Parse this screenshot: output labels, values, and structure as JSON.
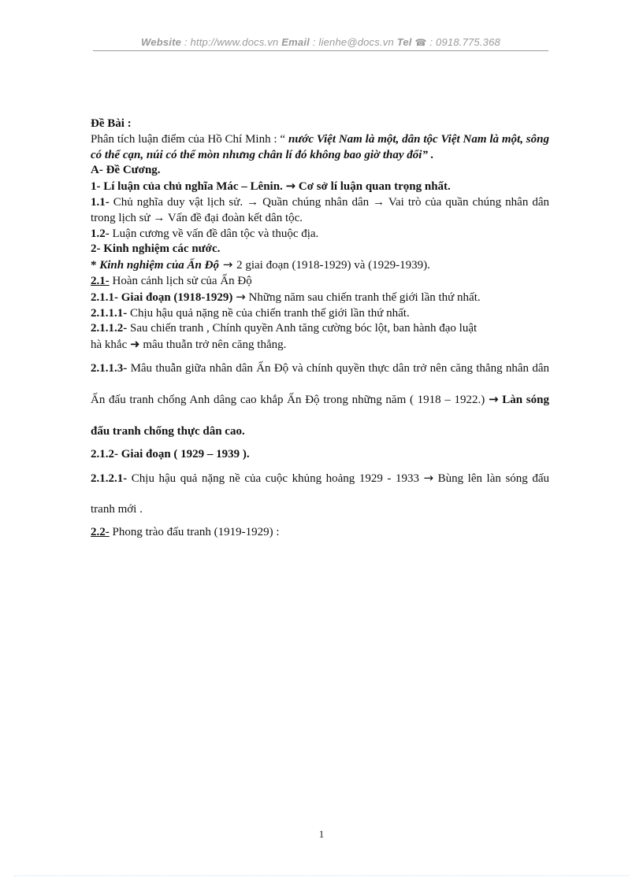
{
  "header": {
    "website_label": "Website",
    "website_sep": " : ",
    "website_url": "http://www.docs.vn",
    "email_label": "Email",
    "email_sep": "  : ",
    "email_value": "lienhe@docs.vn",
    "tel_label": "Tel",
    "phone_icon": "telephone-icon",
    "phone_glyph": "☎",
    "tel_sep": " : ",
    "tel_value": "0918.775.368"
  },
  "document": {
    "title": "Đề Bài :",
    "prompt_lead": "Phân tích luận  điểm  của Hồ Chí Minh  : “ ",
    "prompt_quote": "nước Việt Nam là một, dân tộc Việt Nam là một, sông có thể cạn, núi có thể mòn nhưng chân lí đó không bao giờ thay đổi",
    "prompt_tail": "” .",
    "section_a": "A- Đề Cương.",
    "outline": [
      {
        "id": "1",
        "num": "1- Lí luận  của chủ nghĩa Mác – Lênin. ",
        "arrow": "→",
        "rest": " Cơ sở lí luận  quan trọng nhất."
      },
      {
        "id": "1.1",
        "num": "1.1- ",
        "text": "Chủ nghĩa  duy vật lịch  sử. → Quần chúng nhân  dân → Vai trò của quần chúng nhân dân trong  lịch  sử → Vấn đề đại đoàn kết dân tộc."
      },
      {
        "id": "1.2",
        "num": "1.2- ",
        "text": "Luận  cương về vấn  đề dân tộc và thuộc  địa."
      },
      {
        "id": "2",
        "num": "2- Kinh  nghiệm  các nước."
      },
      {
        "id": "2-star",
        "star": "* ",
        "bolditalic": "Kinh nghiệm của Ấn Độ",
        "arrow": " → ",
        "rest": "2 giai  đoạn (1918-1929) và (1929-1939)."
      },
      {
        "id": "2.1",
        "num": "2.1-",
        "text": " Hoàn cảnh lịch  sử của Ấn Độ"
      },
      {
        "id": "2.1.1",
        "num": "2.1.1- Giai đoạn (1918-1929) ",
        "arrow": "→",
        "rest": " Những năm sau chiến  tranh thế giới  lần thứ nhất."
      },
      {
        "id": "2.1.1.1",
        "num": "2.1.1.1- ",
        "text": "Chịu hậu  quả nặng  nề của chiến  tranh thế giới  lần thứ nhất."
      },
      {
        "id": "2.1.1.2",
        "num": "2.1.1.2- ",
        "text": "Sau chiến  tranh , Chính  quyền Anh tăng cường bóc lột, ban hành  đạo luật",
        "line2_pre": "hà khắc ",
        "line2_arrow": "➜",
        "line2_post": " mâu  thuẫn trở nên  căng  thẳng."
      },
      {
        "id": "2.1.1.3",
        "num": "2.1.1.3- ",
        "text": "Mâu thuẫn  giữa nhân  dân Ấn Độ và chính  quyền  thực  dân trở nên  căng thẳng  nhân  dân Ấn đấu tranh  chống  Anh  dâng cao khắp Ấn Độ trong những  năm ( 1918 – 1922.) ",
        "arrow": "→",
        "bold_tail": " Làn sóng đấu tranh  chống thực dân cao."
      },
      {
        "id": "2.1.2",
        "num": "2.1.2- Giai đoạn ( 1929 – 1939 )."
      },
      {
        "id": "2.1.2.1",
        "num": "2.1.2.1- ",
        "text": "Chịu hậu  quả nặng  nề của cuộc khủng  hoảng  1929 - 1933 ",
        "arrow": "→",
        "rest": " Bùng lên làn sóng đấu tranh mới ."
      },
      {
        "id": "2.2",
        "num": "2.2-",
        "text": " Phong trào đấu tranh (1919-1929) :"
      }
    ],
    "page_number": "1"
  }
}
